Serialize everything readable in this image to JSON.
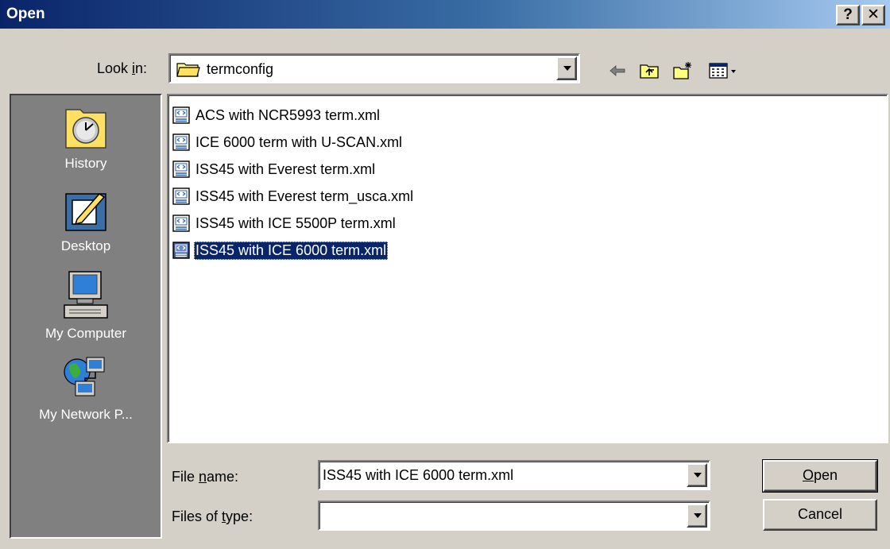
{
  "window": {
    "title": "Open",
    "help_glyph": "?",
    "close_glyph": "✕"
  },
  "lookin": {
    "label_pre": "Look ",
    "label_key": "i",
    "label_post": "n:",
    "value": "termconfig"
  },
  "toolbar": {
    "icons": [
      "back-arrow-icon",
      "up-folder-icon",
      "new-folder-icon",
      "view-menu-icon"
    ]
  },
  "places": [
    {
      "label": "History",
      "icon": "history-icon"
    },
    {
      "label": "Desktop",
      "icon": "desktop-icon"
    },
    {
      "label": "My Computer",
      "icon": "my-computer-icon"
    },
    {
      "label": "My Network P...",
      "icon": "network-places-icon"
    }
  ],
  "files": [
    {
      "name": "ACS with NCR5993 term.xml",
      "selected": false
    },
    {
      "name": "ICE 6000 term with U-SCAN.xml",
      "selected": false
    },
    {
      "name": "ISS45 with Everest term.xml",
      "selected": false
    },
    {
      "name": "ISS45 with Everest term_usca.xml",
      "selected": false
    },
    {
      "name": "ISS45 with ICE 5500P term.xml",
      "selected": false
    },
    {
      "name": "ISS45 with ICE 6000 term.xml",
      "selected": true
    }
  ],
  "filename": {
    "label_pre": "File ",
    "label_key": "n",
    "label_post": "ame:",
    "value": "ISS45 with ICE 6000 term.xml"
  },
  "filetype": {
    "label_pre": "Files of ",
    "label_key": "t",
    "label_post": "ype:",
    "value": ""
  },
  "buttons": {
    "open_key": "O",
    "open_rest": "pen",
    "cancel": "Cancel"
  },
  "colors": {
    "title_start": "#0a246a",
    "title_end": "#a6caf0",
    "face": "#d4d0c8",
    "places_bg": "#808080",
    "selection": "#0a246a"
  }
}
